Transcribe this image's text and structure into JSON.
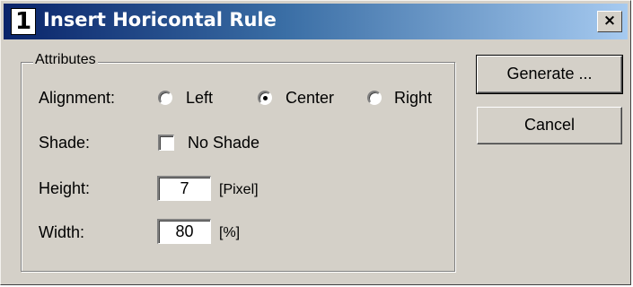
{
  "window": {
    "title": "Insert Horicontal Rule",
    "icon_label": "1",
    "close_label": "×"
  },
  "attributes": {
    "group_label": "Attributes",
    "alignment": {
      "label": "Alignment:",
      "options": [
        "Left",
        "Center",
        "Right"
      ],
      "selected": "Center"
    },
    "shade": {
      "label": "Shade:",
      "checkbox_label": "No Shade",
      "checked": false
    },
    "height": {
      "label": "Height:",
      "value": "7",
      "unit": "[Pixel]"
    },
    "width": {
      "label": "Width:",
      "value": "80",
      "unit": "[%]"
    }
  },
  "buttons": {
    "generate": "Generate ...",
    "cancel": "Cancel"
  },
  "colors": {
    "title_gradient_start": "#0a246a",
    "title_gradient_end": "#a6caf0",
    "face": "#d4d0c8"
  }
}
